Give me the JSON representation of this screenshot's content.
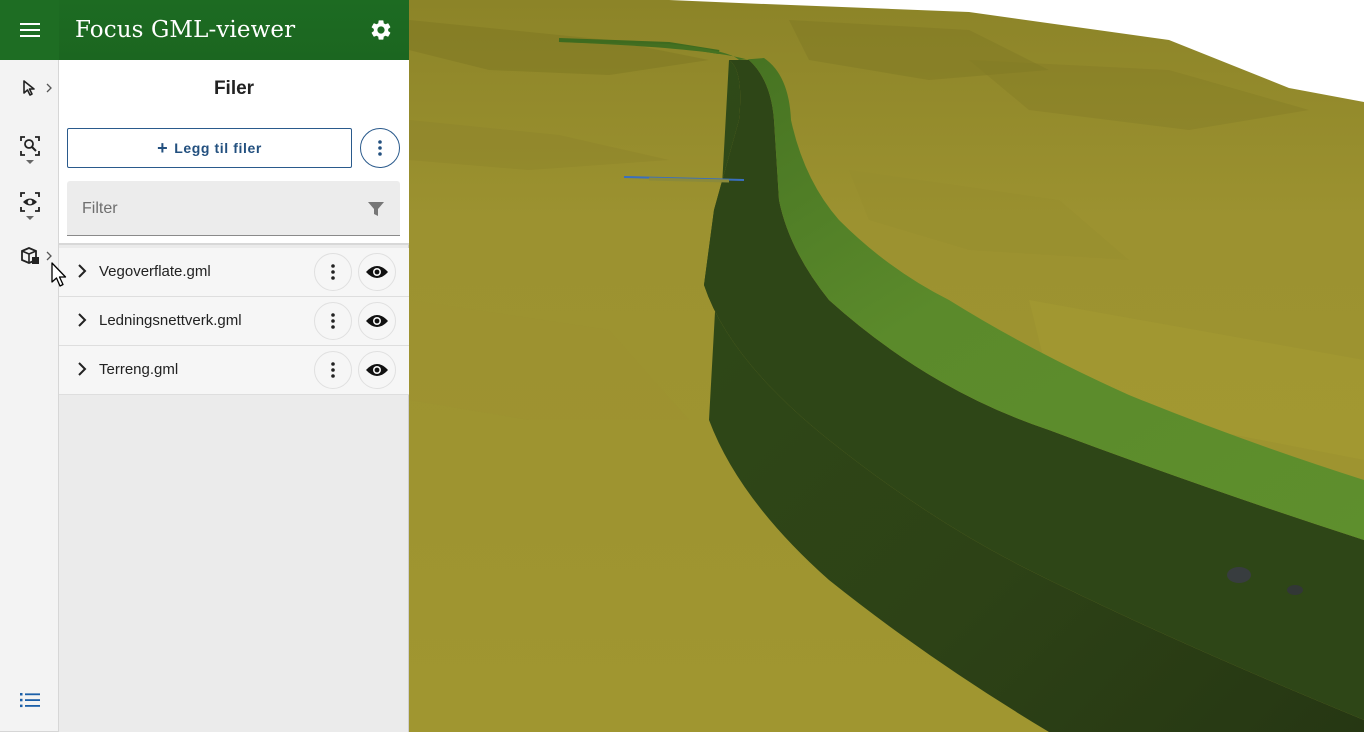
{
  "app": {
    "title": "Focus GML-viewer",
    "brand_color": "#1e6d23",
    "accent_color": "#23507f"
  },
  "rail": {
    "items": [
      {
        "name": "select-tool",
        "icon": "cursor-arrow-icon"
      },
      {
        "name": "zoom-to-tool",
        "icon": "zoom-person-icon"
      },
      {
        "name": "visibility-tool",
        "icon": "eye-focus-icon"
      },
      {
        "name": "objects-tool",
        "icon": "boxes-icon"
      },
      {
        "name": "list-tool",
        "icon": "list-icon"
      }
    ]
  },
  "panel": {
    "section_title": "Filer",
    "add_files_label": "Legg til filer",
    "filter_placeholder": "Filter"
  },
  "files": [
    {
      "name": "Vegoverflate.gml",
      "visible": true
    },
    {
      "name": "Ledningsnettverk.gml",
      "visible": true
    },
    {
      "name": "Terreng.gml",
      "visible": true
    }
  ],
  "scene": {
    "terrain_color": "#a39a33",
    "road_top_color": "#5a8a2a",
    "road_side_color": "#2f4417"
  }
}
